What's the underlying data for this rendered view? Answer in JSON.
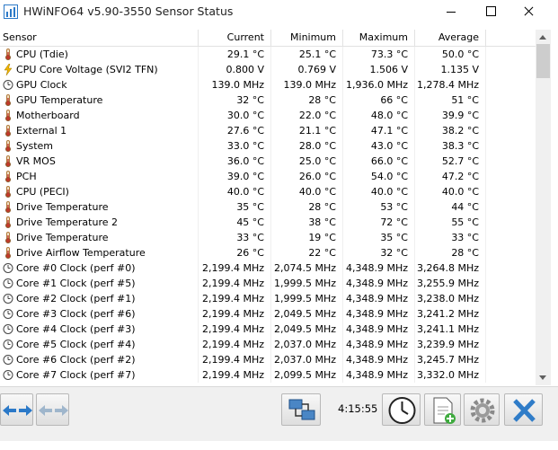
{
  "window": {
    "title": "HWiNFO64 v5.90-3550 Sensor Status"
  },
  "columns": {
    "sensor": "Sensor",
    "current": "Current",
    "minimum": "Minimum",
    "maximum": "Maximum",
    "average": "Average"
  },
  "rows": [
    {
      "icon": "thermometer-icon",
      "sensor": "CPU (Tdie)",
      "current": "29.1 °C",
      "minimum": "25.1 °C",
      "maximum": "73.3 °C",
      "average": "50.0 °C"
    },
    {
      "icon": "voltage-icon",
      "sensor": "CPU Core Voltage (SVI2 TFN)",
      "current": "0.800 V",
      "minimum": "0.769 V",
      "maximum": "1.506 V",
      "average": "1.135 V"
    },
    {
      "icon": "clock-icon",
      "sensor": "GPU Clock",
      "current": "139.0 MHz",
      "minimum": "139.0 MHz",
      "maximum": "1,936.0 MHz",
      "average": "1,278.4 MHz"
    },
    {
      "icon": "thermometer-icon",
      "sensor": "GPU Temperature",
      "current": "32 °C",
      "minimum": "28 °C",
      "maximum": "66 °C",
      "average": "51 °C"
    },
    {
      "icon": "thermometer-icon",
      "sensor": "Motherboard",
      "current": "30.0 °C",
      "minimum": "22.0 °C",
      "maximum": "48.0 °C",
      "average": "39.9 °C"
    },
    {
      "icon": "thermometer-icon",
      "sensor": "External 1",
      "current": "27.6 °C",
      "minimum": "21.1 °C",
      "maximum": "47.1 °C",
      "average": "38.2 °C"
    },
    {
      "icon": "thermometer-icon",
      "sensor": "System",
      "current": "33.0 °C",
      "minimum": "28.0 °C",
      "maximum": "43.0 °C",
      "average": "38.3 °C"
    },
    {
      "icon": "thermometer-icon",
      "sensor": "VR MOS",
      "current": "36.0 °C",
      "minimum": "25.0 °C",
      "maximum": "66.0 °C",
      "average": "52.7 °C"
    },
    {
      "icon": "thermometer-icon",
      "sensor": "PCH",
      "current": "39.0 °C",
      "minimum": "26.0 °C",
      "maximum": "54.0 °C",
      "average": "47.2 °C"
    },
    {
      "icon": "thermometer-icon",
      "sensor": "CPU (PECI)",
      "current": "40.0 °C",
      "minimum": "40.0 °C",
      "maximum": "40.0 °C",
      "average": "40.0 °C"
    },
    {
      "icon": "thermometer-icon",
      "sensor": "Drive Temperature",
      "current": "35 °C",
      "minimum": "28 °C",
      "maximum": "53 °C",
      "average": "44 °C"
    },
    {
      "icon": "thermometer-icon",
      "sensor": "Drive Temperature 2",
      "current": "45 °C",
      "minimum": "38 °C",
      "maximum": "72 °C",
      "average": "55 °C"
    },
    {
      "icon": "thermometer-icon",
      "sensor": "Drive Temperature",
      "current": "33 °C",
      "minimum": "19 °C",
      "maximum": "35 °C",
      "average": "33 °C"
    },
    {
      "icon": "thermometer-icon",
      "sensor": "Drive Airflow Temperature",
      "current": "26 °C",
      "minimum": "22 °C",
      "maximum": "32 °C",
      "average": "28 °C"
    },
    {
      "icon": "clock-icon",
      "sensor": "Core #0 Clock (perf #0)",
      "current": "2,199.4 MHz",
      "minimum": "2,074.5 MHz",
      "maximum": "4,348.9 MHz",
      "average": "3,264.8 MHz"
    },
    {
      "icon": "clock-icon",
      "sensor": "Core #1 Clock (perf #5)",
      "current": "2,199.4 MHz",
      "minimum": "1,999.5 MHz",
      "maximum": "4,348.9 MHz",
      "average": "3,255.9 MHz"
    },
    {
      "icon": "clock-icon",
      "sensor": "Core #2 Clock (perf #1)",
      "current": "2,199.4 MHz",
      "minimum": "1,999.5 MHz",
      "maximum": "4,348.9 MHz",
      "average": "3,238.0 MHz"
    },
    {
      "icon": "clock-icon",
      "sensor": "Core #3 Clock (perf #6)",
      "current": "2,199.4 MHz",
      "minimum": "2,049.5 MHz",
      "maximum": "4,348.9 MHz",
      "average": "3,241.2 MHz"
    },
    {
      "icon": "clock-icon",
      "sensor": "Core #4 Clock (perf #3)",
      "current": "2,199.4 MHz",
      "minimum": "2,049.5 MHz",
      "maximum": "4,348.9 MHz",
      "average": "3,241.1 MHz"
    },
    {
      "icon": "clock-icon",
      "sensor": "Core #5 Clock (perf #4)",
      "current": "2,199.4 MHz",
      "minimum": "2,037.0 MHz",
      "maximum": "4,348.9 MHz",
      "average": "3,239.9 MHz"
    },
    {
      "icon": "clock-icon",
      "sensor": "Core #6 Clock (perf #2)",
      "current": "2,199.4 MHz",
      "minimum": "2,037.0 MHz",
      "maximum": "4,348.9 MHz",
      "average": "3,245.7 MHz"
    },
    {
      "icon": "clock-icon",
      "sensor": "Core #7 Clock (perf #7)",
      "current": "2,199.4 MHz",
      "minimum": "2,099.5 MHz",
      "maximum": "4,348.9 MHz",
      "average": "3,332.0 MHz"
    }
  ],
  "toolbar": {
    "timer": "4:15:55",
    "icons": {
      "nav_left": "arrows-left-right-icon",
      "nav_right": "arrows-inactive-icon",
      "network": "network-icon",
      "clock": "clock-icon",
      "report": "report-add-icon",
      "settings": "gear-icon",
      "close": "close-icon"
    }
  },
  "colors": {
    "accent": "#2b79c8",
    "close_x": "#2f7cc8",
    "thermometer": "#b07a3a",
    "voltage": "#f0b400"
  }
}
